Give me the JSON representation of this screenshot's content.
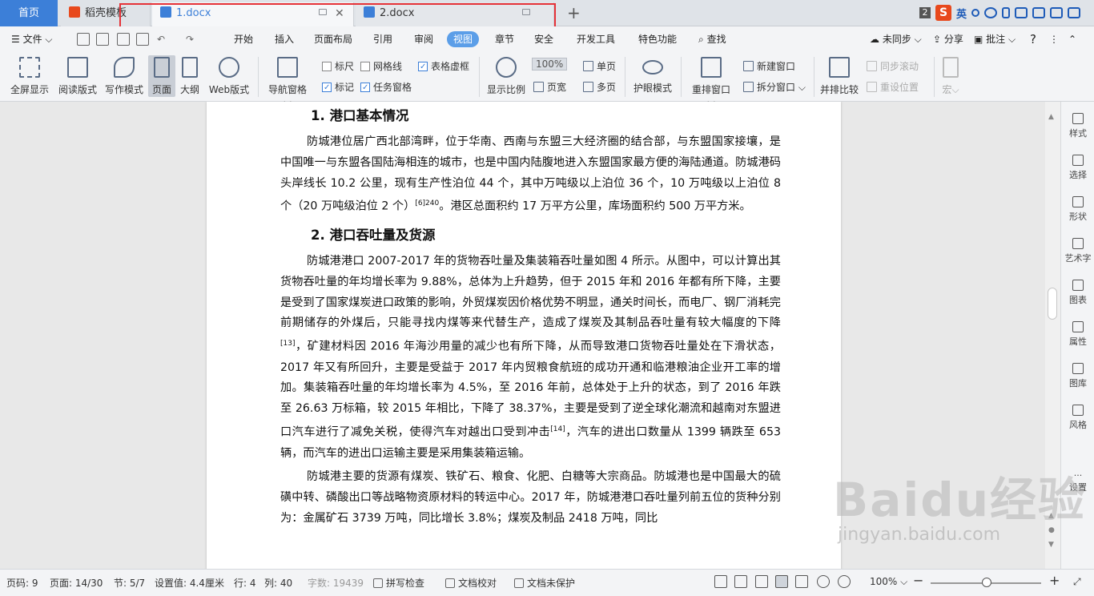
{
  "tabs": {
    "home": "首页",
    "template": "稻壳模板",
    "doc1": "1.docx",
    "doc2": "2.docx",
    "add": "+"
  },
  "tray": {
    "badge": "2",
    "logo": "S",
    "ime": "英"
  },
  "menu": {
    "file": "文件",
    "items": [
      "开始",
      "插入",
      "页面布局",
      "引用",
      "审阅",
      "视图",
      "章节",
      "安全",
      "开发工具",
      "特色功能"
    ],
    "search": "查找",
    "sync": "未同步",
    "share": "分享",
    "comment": "批注",
    "help": "?"
  },
  "ribbon": {
    "fullscreen": "全屏显示",
    "read": "阅读版式",
    "write": "写作模式",
    "page": "页面",
    "outline": "大纲",
    "web": "Web版式",
    "nav": "导航窗格",
    "ruler": "标尺",
    "gridlines": "网格线",
    "table_lines": "表格虚框",
    "marks": "标记",
    "taskpane": "任务窗格",
    "zoom_ratio": "显示比例",
    "zoom_value": "100%",
    "page_width": "页宽",
    "single_page": "单页",
    "multi_page": "多页",
    "eye_mode": "护眼模式",
    "rearrange": "重排窗口",
    "new_window": "新建窗口",
    "split_window": "拆分窗口",
    "side_by_side": "并排比较",
    "sync_scroll": "同步滚动",
    "reset_pos": "重设位置",
    "macro": "宏"
  },
  "document": {
    "h1": "1. 港口基本情况",
    "p1": "防城港位居广西北部湾畔，位于华南、西南与东盟三大经济圈的结合部，与东盟国家接壤，是中国唯一与东盟各国陆海相连的城市，也是中国内陆腹地进入东盟国家最方便的海陆通道。防城港码头岸线长 10.2 公里，现有生产性泊位 44 个，其中万吨级以上泊位 36 个，10 万吨级以上泊位 8 个（20 万吨级泊位 2 个）",
    "p1_sup": "[6]240",
    "p1_tail": "。港区总面积约 17 万平方公里，库场面积约 500 万平方米。",
    "h2": "2. 港口吞吐量及货源",
    "p2a": "防城港港口 2007-2017 年的货物吞吐量及集装箱吞吐量如图 4 所示。从图中，可以计算出其货物吞吐量的年均增长率为 9.88%，总体为上升趋势，但于 2015 年和 2016 年都有所下降，主要是受到了国家煤炭进口政策的影响，外贸煤炭因价格优势不明显，通关时间长，而电厂、钢厂消耗完前期储存的外煤后，只能寻找内煤等来代替生产，造成了煤炭及其制品吞吐量有较大幅度的下降",
    "p2a_sup": "[13]",
    "p2b": "，矿建材料因 2016 年海沙用量的减少也有所下降，从而导致港口货物吞吐量处在下滑状态，2017 年又有所回升，主要是受益于 2017 年内贸粮食航班的成功开通和临港粮油企业开工率的增加。集装箱吞吐量的年均增长率为 4.5%，至 2016 年前，总体处于上升的状态，到了 2016 年跌至 26.63 万标箱，较 2015 年相比，下降了 38.37%，主要是受到了逆全球化潮流和越南对东盟进口汽车进行了减免关税，使得汽车对越出口受到冲击",
    "p2b_sup": "[14]",
    "p2c": "，汽车的进出口数量从 1399 辆跌至 653 辆，而汽车的进出口运输主要是采用集装箱运输。",
    "p3": "防城港主要的货源有煤炭、铁矿石、粮食、化肥、白糖等大宗商品。防城港也是中国最大的硫磺中转、磷酸出口等战略物资原材料的转运中心。2017 年，防城港港口吞吐量列前五位的货种分别为：金属矿石 3739 万吨，同比增长 3.8%；煤炭及制品 2418 万吨，同比"
  },
  "right_panel": [
    "样式",
    "选择",
    "形状",
    "艺术字",
    "图表",
    "属性",
    "图库",
    "风格",
    "设置"
  ],
  "status": {
    "page_no": "页码: 9",
    "pages": "页面: 14/30",
    "section": "节: 5/7",
    "setting": "设置值: 4.4厘米",
    "row": "行: 4",
    "col": "列: 40",
    "words": "字数: 19439",
    "spell": "拼写检查",
    "proof": "文档校对",
    "protect": "文档未保护",
    "zoom": "100%"
  },
  "watermark": {
    "brand": "Baidu经验",
    "url": "jingyan.baidu.com"
  }
}
